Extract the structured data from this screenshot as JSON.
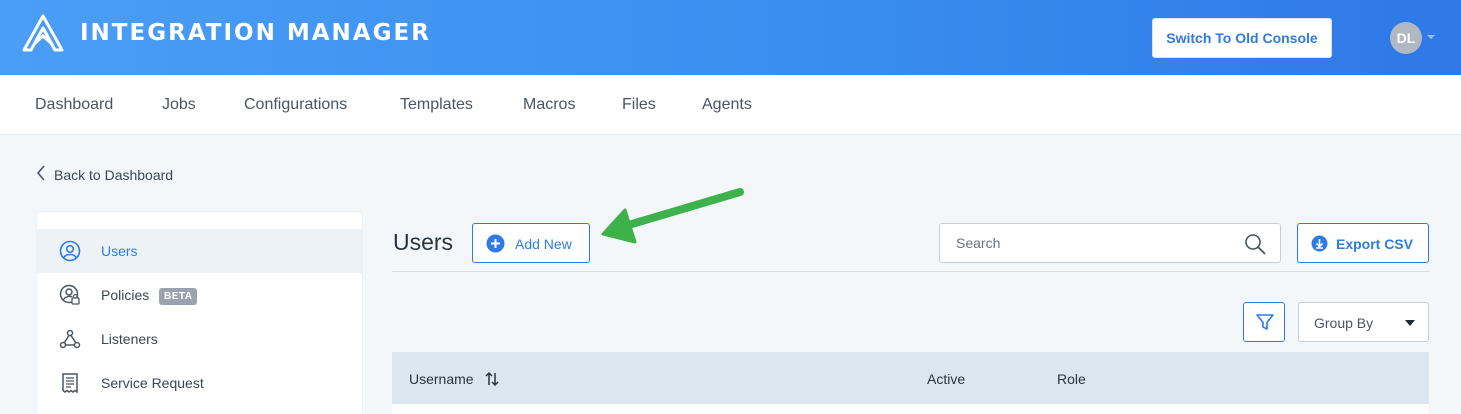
{
  "header": {
    "title": "INTEGRATION MANAGER",
    "logo_icon": "integration-manager-logo",
    "switch_button": "Switch To Old Console",
    "avatar_initials": "DL"
  },
  "nav": {
    "items": [
      "Dashboard",
      "Jobs",
      "Configurations",
      "Templates",
      "Macros",
      "Files",
      "Agents"
    ]
  },
  "back_link": "Back to Dashboard",
  "sidebar": {
    "items": [
      {
        "label": "Users",
        "icon": "user-circle-icon",
        "active": true
      },
      {
        "label": "Policies",
        "icon": "user-lock-icon",
        "badge": "BETA"
      },
      {
        "label": "Listeners",
        "icon": "webhook-icon"
      },
      {
        "label": "Service Request",
        "icon": "receipt-icon"
      }
    ]
  },
  "main": {
    "title": "Users",
    "add_button": "Add New",
    "search_placeholder": "Search",
    "export_button": "Export CSV",
    "group_by": "Group By",
    "table": {
      "columns": [
        "Username",
        "Active",
        "Role"
      ]
    }
  },
  "colors": {
    "accent": "#2f7ae5",
    "header_gradient_start": "#4a9ef5",
    "header_gradient_end": "#2f78e6",
    "annotation_arrow": "#3db24a"
  }
}
